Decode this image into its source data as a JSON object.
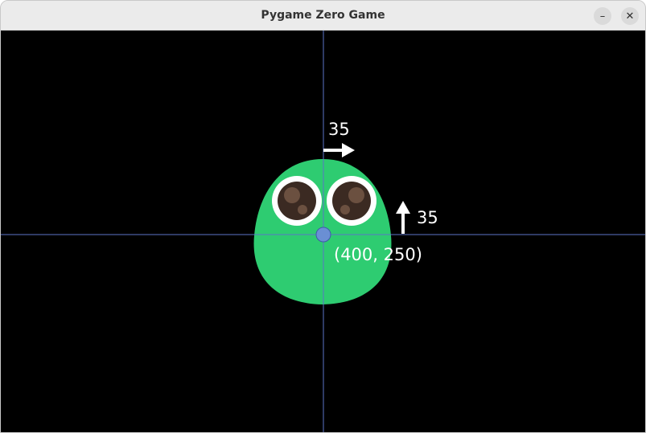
{
  "window": {
    "title": "Pygame Zero Game",
    "minimize_glyph": "–",
    "close_glyph": "✕"
  },
  "canvas": {
    "background_color": "#000000",
    "axis_color": "#5b73c8",
    "sprite": {
      "name": "green-blob-character",
      "body_color": "#2ecc71",
      "eye_white_color": "#ffffff",
      "pupil_color": "#3b2a22"
    },
    "anchor_point_color": "#6a8fd4",
    "position_label": "(400, 250)",
    "x_offset_label": "35",
    "y_offset_label": "35"
  }
}
